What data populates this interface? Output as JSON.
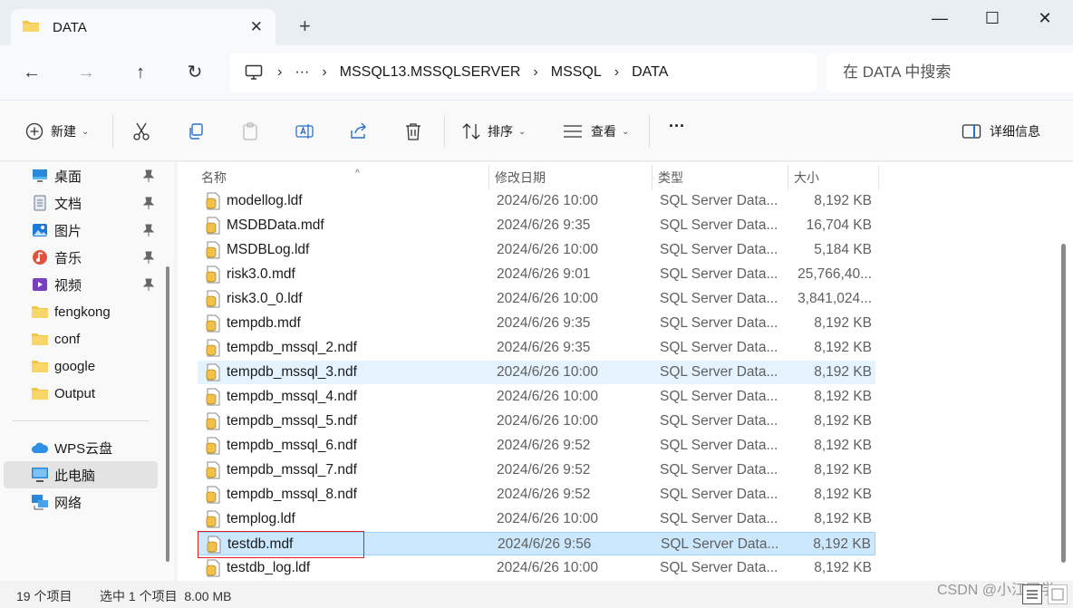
{
  "window": {
    "tab_title": "DATA",
    "tab_close": "✕",
    "new_tab": "+",
    "minimize": "—",
    "maximize": "☐",
    "close": "✕"
  },
  "address": {
    "overflow": "···",
    "crumbs": [
      "MSSQL13.MSSQLSERVER",
      "MSSQL",
      "DATA"
    ],
    "search_placeholder": "在 DATA 中搜索"
  },
  "toolbar": {
    "new_label": "新建",
    "sort_label": "排序",
    "view_label": "查看",
    "more_label": "···",
    "details_label": "详细信息"
  },
  "sidebar": {
    "quick_access": [
      {
        "label": "桌面",
        "icon": "desktop-icon",
        "pinned": true
      },
      {
        "label": "文档",
        "icon": "documents-icon",
        "pinned": true
      },
      {
        "label": "图片",
        "icon": "pictures-icon",
        "pinned": true
      },
      {
        "label": "音乐",
        "icon": "music-icon",
        "pinned": true
      },
      {
        "label": "视频",
        "icon": "videos-icon",
        "pinned": true
      },
      {
        "label": "fengkong",
        "icon": "folder-icon",
        "pinned": false
      },
      {
        "label": "conf",
        "icon": "folder-icon",
        "pinned": false
      },
      {
        "label": "google",
        "icon": "folder-icon",
        "pinned": false
      },
      {
        "label": "Output",
        "icon": "folder-icon",
        "pinned": false
      }
    ],
    "locations": [
      {
        "label": "WPS云盘",
        "icon": "cloud-icon"
      },
      {
        "label": "此电脑",
        "icon": "this-pc-icon",
        "selected": true
      },
      {
        "label": "网络",
        "icon": "network-icon"
      }
    ]
  },
  "columns": {
    "name": "名称",
    "date": "修改日期",
    "type": "类型",
    "size": "大小"
  },
  "files": [
    {
      "name": "modellog.ldf",
      "date": "2024/6/26 10:00",
      "type": "SQL Server Data...",
      "size": "8,192 KB"
    },
    {
      "name": "MSDBData.mdf",
      "date": "2024/6/26 9:35",
      "type": "SQL Server Data...",
      "size": "16,704 KB"
    },
    {
      "name": "MSDBLog.ldf",
      "date": "2024/6/26 10:00",
      "type": "SQL Server Data...",
      "size": "5,184 KB"
    },
    {
      "name": "risk3.0.mdf",
      "date": "2024/6/26 9:01",
      "type": "SQL Server Data...",
      "size": "25,766,40..."
    },
    {
      "name": "risk3.0_0.ldf",
      "date": "2024/6/26 10:00",
      "type": "SQL Server Data...",
      "size": "3,841,024..."
    },
    {
      "name": "tempdb.mdf",
      "date": "2024/6/26 9:35",
      "type": "SQL Server Data...",
      "size": "8,192 KB"
    },
    {
      "name": "tempdb_mssql_2.ndf",
      "date": "2024/6/26 9:35",
      "type": "SQL Server Data...",
      "size": "8,192 KB"
    },
    {
      "name": "tempdb_mssql_3.ndf",
      "date": "2024/6/26 10:00",
      "type": "SQL Server Data...",
      "size": "8,192 KB",
      "state": "hover"
    },
    {
      "name": "tempdb_mssql_4.ndf",
      "date": "2024/6/26 10:00",
      "type": "SQL Server Data...",
      "size": "8,192 KB"
    },
    {
      "name": "tempdb_mssql_5.ndf",
      "date": "2024/6/26 10:00",
      "type": "SQL Server Data...",
      "size": "8,192 KB"
    },
    {
      "name": "tempdb_mssql_6.ndf",
      "date": "2024/6/26 9:52",
      "type": "SQL Server Data...",
      "size": "8,192 KB"
    },
    {
      "name": "tempdb_mssql_7.ndf",
      "date": "2024/6/26 9:52",
      "type": "SQL Server Data...",
      "size": "8,192 KB"
    },
    {
      "name": "tempdb_mssql_8.ndf",
      "date": "2024/6/26 9:52",
      "type": "SQL Server Data...",
      "size": "8,192 KB"
    },
    {
      "name": "templog.ldf",
      "date": "2024/6/26 10:00",
      "type": "SQL Server Data...",
      "size": "8,192 KB"
    },
    {
      "name": "testdb.mdf",
      "date": "2024/6/26 9:56",
      "type": "SQL Server Data...",
      "size": "8,192 KB",
      "state": "selected"
    },
    {
      "name": "testdb_log.ldf",
      "date": "2024/6/26 10:00",
      "type": "SQL Server Data...",
      "size": "8,192 KB"
    }
  ],
  "status": {
    "item_count": "19 个项目",
    "selection": "选中 1 个项目  8.00 MB"
  },
  "watermark": "CSDN @小江同学",
  "colors": {
    "accent": "#0067c0",
    "selected_row": "#cce8ff",
    "hover_row": "#e5f3ff",
    "folder": "#f4c542",
    "highlight_box": "#e02020"
  }
}
